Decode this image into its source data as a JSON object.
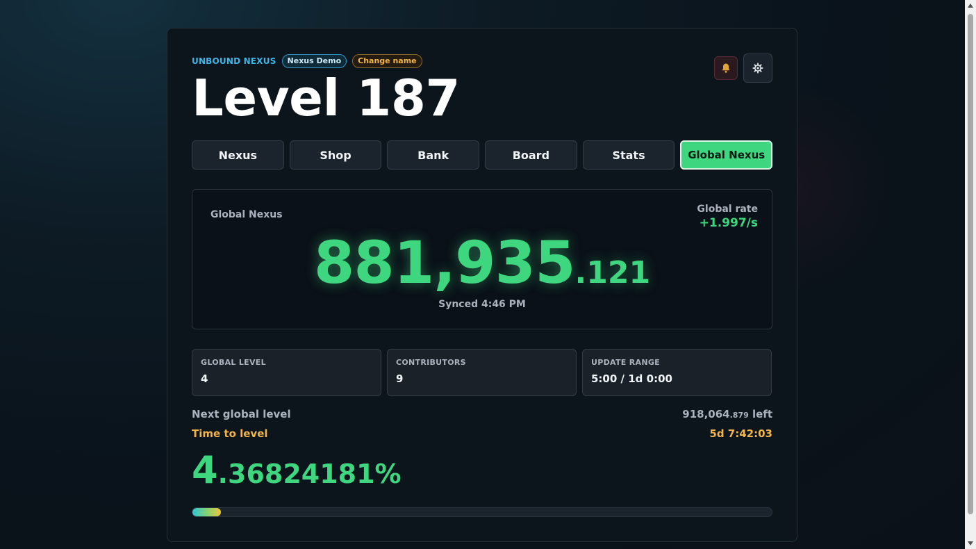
{
  "header": {
    "brand": "UNBOUND NEXUS",
    "demo_badge": "Nexus Demo",
    "change_name": "Change name",
    "title": "Level 187",
    "bell_icon": "bell-icon",
    "settings_icon": "gear-icon"
  },
  "tabs": [
    {
      "label": "Nexus"
    },
    {
      "label": "Shop"
    },
    {
      "label": "Bank"
    },
    {
      "label": "Board"
    },
    {
      "label": "Stats"
    },
    {
      "label": "Global Nexus",
      "active": true
    }
  ],
  "global_panel": {
    "label": "Global Nexus",
    "rate_label": "Global rate",
    "rate_value": "+1.997/s",
    "value_int": "881,935",
    "value_dec": ".121",
    "synced": "Synced 4:46 PM"
  },
  "stats": [
    {
      "label": "GLOBAL LEVEL",
      "value": "4"
    },
    {
      "label": "CONTRIBUTORS",
      "value": "9"
    },
    {
      "label": "UPDATE RANGE",
      "value": "5:00 / 1d 0:00"
    }
  ],
  "progress": {
    "next_label": "Next global level",
    "left_int": "918,064",
    "left_dec": ".879",
    "left_suffix": " left",
    "time_label": "Time to level",
    "time_value": "5d 7:42:03",
    "percent_int": "4",
    "percent_rest": ".36824181%",
    "fraction": 0.0436824181
  },
  "colors": {
    "accent_green": "#3ed67e",
    "accent_blue": "#3fb6e6",
    "accent_amber": "#f3b54a"
  }
}
